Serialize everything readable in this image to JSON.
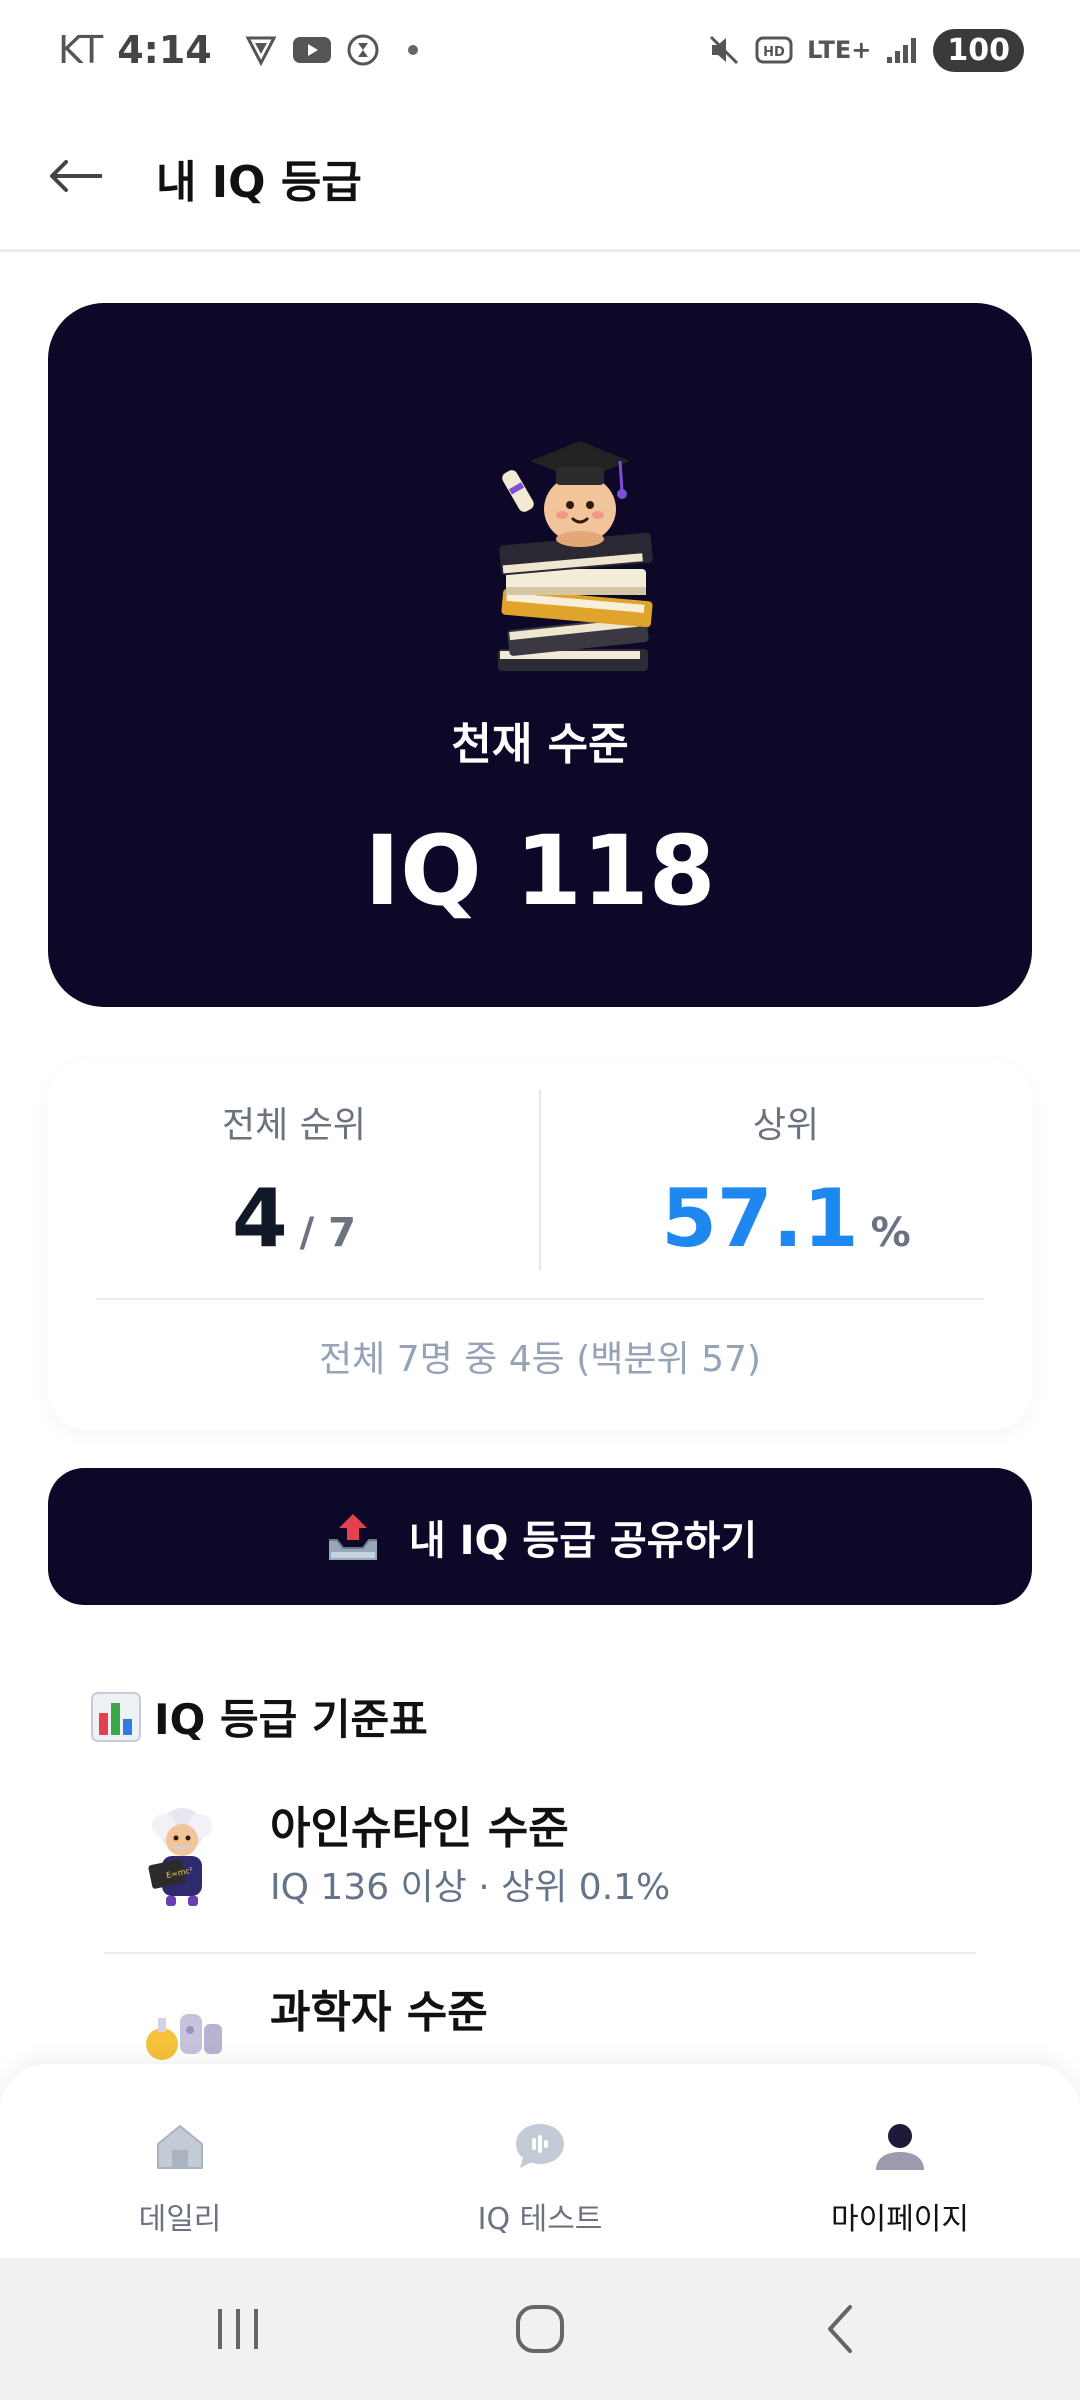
{
  "status_bar": {
    "carrier": "KT",
    "time": "4:14",
    "battery": "100",
    "network": "LTE+"
  },
  "header": {
    "title": "내 IQ 등급"
  },
  "hero": {
    "level": "천재 수준",
    "iq": "IQ 118"
  },
  "stats": {
    "rank_label": "전체 순위",
    "rank_value": "4",
    "rank_total": "/ 7",
    "percentile_label": "상위",
    "percentile_value": "57.1",
    "percentile_unit": "%",
    "summary": "전체 7명 중 4등 (백분위 57)",
    "accent_color": "#1e88f0"
  },
  "share": {
    "label": "내 IQ 등급 공유하기"
  },
  "grade_table": {
    "title": "IQ 등급 기준표",
    "items": [
      {
        "name": "아인슈타인 수준",
        "desc": "IQ 136 이상 · 상위 0.1%"
      },
      {
        "name": "과학자 수준",
        "desc": ""
      }
    ]
  },
  "bottom_nav": {
    "items": [
      {
        "label": "데일리",
        "icon": "home-icon"
      },
      {
        "label": "IQ 테스트",
        "icon": "chat-bubble-icon"
      },
      {
        "label": "마이페이지",
        "icon": "person-icon"
      }
    ],
    "active_index": 2
  },
  "theme": {
    "primary": "#0d0728"
  }
}
